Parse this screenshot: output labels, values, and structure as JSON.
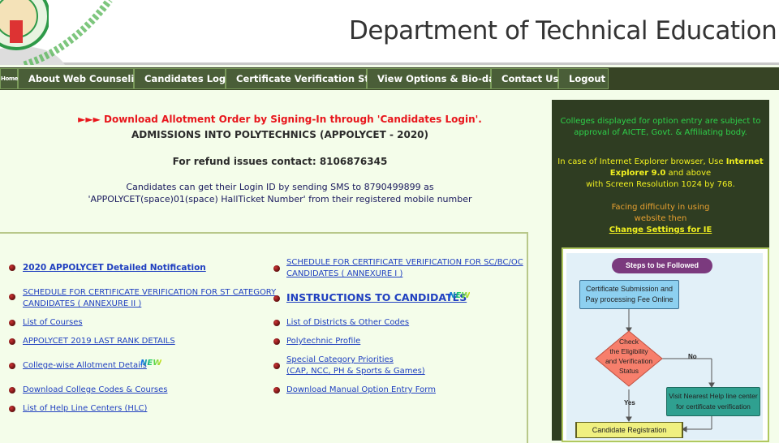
{
  "header": {
    "title": "Department of Technical Education"
  },
  "nav": {
    "items": [
      {
        "label": "Home",
        "visible": "ne"
      },
      {
        "label": "About Web Counseling"
      },
      {
        "label": "Candidates Login"
      },
      {
        "label": "Certificate Verification Status"
      },
      {
        "label": "View Options & Bio-data"
      },
      {
        "label": "Contact Us"
      },
      {
        "label": "Logout"
      }
    ]
  },
  "notices": {
    "allotment": "►►► Download Allotment Order by Signing-In through 'Candidates Login'.",
    "admissions": "ADMISSIONS INTO POLYTECHNICS (APPOLYCET - 2020)",
    "refund": "For refund issues contact: 8106876345",
    "sms_line1": "Candidates can get their Login ID by sending SMS to 8790499899 as",
    "sms_line2": "'APPOLYCET(space)01(space) HallTicket Number' from their registered mobile number"
  },
  "links_left": [
    {
      "label": "2020 APPOLYCET Detailed Notification"
    },
    {
      "label": "SCHEDULE FOR CERTIFICATE VERIFICATION FOR ST CATEGORY",
      "label2": "CANDIDATES ( ANNEXURE II )"
    },
    {
      "label": "List of Courses"
    },
    {
      "label": "APPOLYCET 2019 LAST RANK DETAILS"
    },
    {
      "label": "College-wise Allotment Details",
      "badge": "NEW"
    },
    {
      "label": "Download College Codes & Courses"
    },
    {
      "label": "List of Help Line Centers (HLC)"
    }
  ],
  "links_right": [
    {
      "label": "SCHEDULE FOR CERTIFICATE VERIFICATION FOR SC/BC/OC",
      "label2": "CANDIDATES ( ANNEXURE I )"
    },
    {
      "label": "INSTRUCTIONS TO CANDIDATES",
      "badge": "NEW"
    },
    {
      "label": "List of Districts & Other Codes"
    },
    {
      "label": "Polytechnic Profile"
    },
    {
      "label": "Special Category Priorities",
      "label2": "(CAP, NCC, PH & Sports & Games)"
    },
    {
      "label": "Download Manual Option Entry Form"
    }
  ],
  "panel": {
    "approval1": "Colleges displayed for option entry are subject to",
    "approval2": "approval of AICTE, Govt. & Affiliating body.",
    "ie1a": "In case of Internet Explorer browser, Use ",
    "ie1b": "Internet",
    "ie2a": "Explorer 9.0",
    "ie2b": " and above",
    "ie3": "with Screen Resolution 1024 by 768.",
    "diff1": "Facing difficulty in using",
    "diff2": "website then",
    "settings_link": "Change Settings for IE"
  },
  "flowchart": {
    "title": "Steps to be Followed",
    "step1a": "Certificate Submission and",
    "step1b": "Pay processing Fee Online",
    "check": [
      "Check",
      "the Eligibility",
      "and Verification",
      "Status"
    ],
    "no": "No",
    "yes": "Yes",
    "help1": "Visit Nearest Help line center",
    "help2": "for certificate verification",
    "register": "Candidate Registration"
  },
  "colors": {
    "nav_bg": "#374425",
    "nav_item": "#4a5e38",
    "alert": "#e8161c",
    "link": "#2040c0",
    "panel_bg": "#2f3d22"
  }
}
